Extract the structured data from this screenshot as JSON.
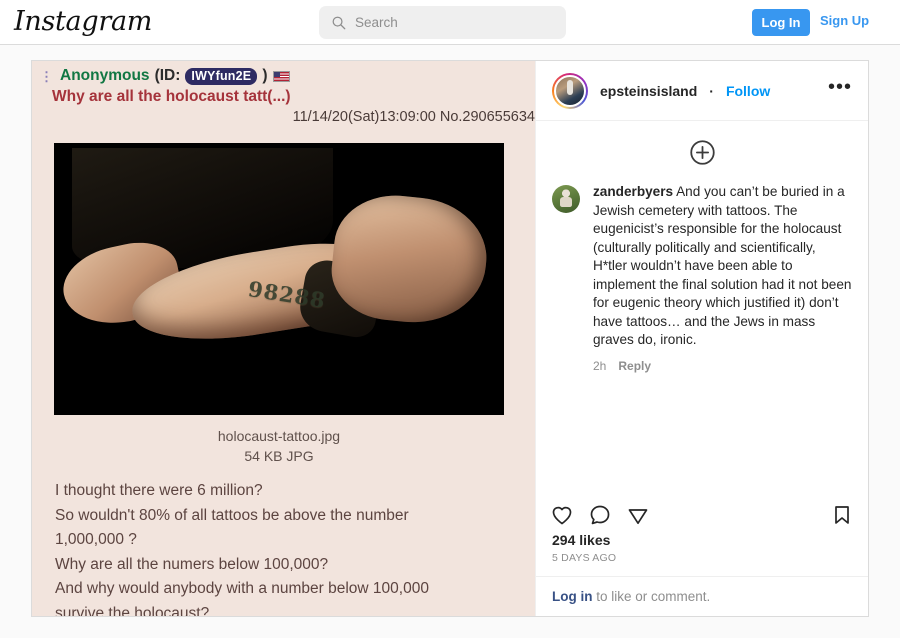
{
  "nav": {
    "logo": "Instagram",
    "search_placeholder": "Search",
    "search_value": "",
    "login_label": "Log In",
    "signup_label": "Sign Up"
  },
  "post": {
    "username": "epsteinsisland",
    "separator": "·",
    "follow_label": "Follow",
    "more_label": "•••",
    "likes": "294 likes",
    "timestamp": "5 DAYS AGO",
    "login_prompt_link": "Log in",
    "login_prompt_rest": " to like or comment."
  },
  "comment": {
    "username": "zanderbyers",
    "text": " And you can’t be buried in a Jewish cemetery with tattoos. The eugenicist’s responsible for the holocaust (culturally politically and scientifically, H*tler wouldn’t have been able to implement the final solution had it not been for eugenic theory which justified it) don’t have tattoos… and the Jews in mass graves do, ironic.",
    "age": "2h",
    "reply_label": "Reply"
  },
  "media": {
    "poster_name": "Anonymous",
    "id_prefix": "(ID:",
    "id_value": "IWYfun2E",
    "id_suffix": ")",
    "subject": "Why are all the holocaust tatt(...)",
    "meta": "11/14/20(Sat)13:09:00 No.290655634",
    "filename": "holocaust-tattoo.jpg",
    "filesize": "54 KB JPG",
    "tattoo_number": "98288",
    "body_lines": [
      "I thought there were 6 million?",
      "So wouldn't 80% of all tattoos be above the number",
      "1,000,000 ?",
      "Why are all the numers below 100,000?",
      "And why would anybody with a number below 100,000",
      "survive the holocaust?"
    ]
  },
  "colors": {
    "accent_blue": "#3897f0",
    "link_blue": "#0095f6",
    "chan_bg": "#f2e4dd",
    "chan_name_green": "#117743",
    "chan_subject_red": "#a5333b",
    "chan_id_badge": "#2e2b63"
  }
}
